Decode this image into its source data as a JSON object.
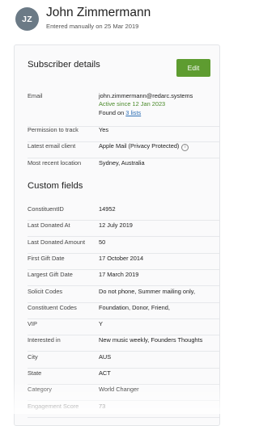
{
  "header": {
    "avatar_initials": "JZ",
    "name": "John Zimmermann",
    "subtitle": "Entered manually on 25 Mar 2019"
  },
  "subscriber_details": {
    "title": "Subscriber details",
    "edit_label": "Edit",
    "email": {
      "label": "Email",
      "address": "john.zimmermann@redarc.systems",
      "active_since": "Active since 12 Jan 2023",
      "found_on_prefix": "Found on ",
      "found_on_link": "3 lists"
    },
    "permission": {
      "label": "Permission to track",
      "value": "Yes"
    },
    "email_client": {
      "label": "Latest email client",
      "value": "Apple Mail (Privacy Protected)",
      "icon": "info-icon"
    },
    "location": {
      "label": "Most recent location",
      "value": "Sydney, Australia"
    }
  },
  "custom_fields": {
    "title": "Custom fields",
    "rows": [
      {
        "label": "ConstituentID",
        "value": "14952"
      },
      {
        "label": "Last Donated At",
        "value": "12 July 2019"
      },
      {
        "label": "Last Donated Amount",
        "value": "50"
      },
      {
        "label": "First Gift Date",
        "value": "17 October 2014"
      },
      {
        "label": "Largest Gift Date",
        "value": "17 March 2019"
      },
      {
        "label": "Solicit Codes",
        "value": "Do not phone, Summer mailing only,"
      },
      {
        "label": "Constituent Codes",
        "value": "Foundation, Donor, Friend,"
      },
      {
        "label": "VIP",
        "value": "Y"
      },
      {
        "label": "Interested in",
        "value": "New music weekly, Founders Thoughts"
      },
      {
        "label": "City",
        "value": "AUS"
      },
      {
        "label": "State",
        "value": "ACT"
      },
      {
        "label": "Category",
        "value": "World Changer"
      },
      {
        "label": "Engagement Score",
        "value": "73"
      }
    ]
  },
  "colors": {
    "accent_green": "#5e9c30",
    "link_blue": "#2d6fb5",
    "active_green": "#4a8a2a",
    "avatar_gray": "#6b7a86"
  }
}
